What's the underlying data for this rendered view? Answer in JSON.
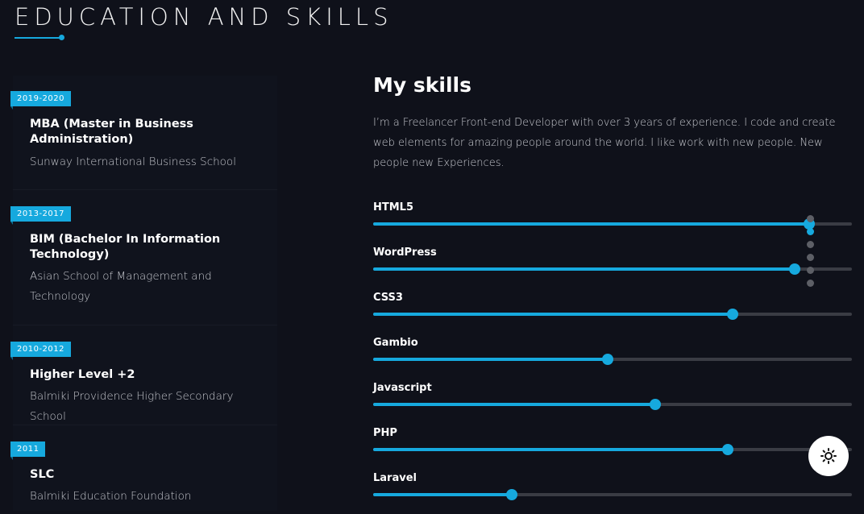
{
  "section": {
    "title": "EDUCATION AND SKILLS"
  },
  "education": [
    {
      "year": "2019-2020",
      "degree": "MBA (Master in Business Administration)",
      "school": "Sunway International Business School"
    },
    {
      "year": "2013-2017",
      "degree": "BIM (Bachelor In Information Technology)",
      "school": "Asian School of Management and Technology"
    },
    {
      "year": "2010-2012",
      "degree": "Higher Level +2",
      "school": "Balmiki Providence Higher Secondary School"
    },
    {
      "year": "2011",
      "degree": "SLC",
      "school": "Balmiki Education Foundation"
    }
  ],
  "skills": {
    "title": "My skills",
    "description": "I’m a Freelancer Front-end Developer with over 3 years of experience. I code and create web elements for amazing people around the world. I like work with new people. New people new Experiences.",
    "items": [
      {
        "name": "HTML5",
        "level": 0.91
      },
      {
        "name": "WordPress",
        "level": 0.88
      },
      {
        "name": "CSS3",
        "level": 0.75
      },
      {
        "name": "Gambio",
        "level": 0.49
      },
      {
        "name": "Javascript",
        "level": 0.59
      },
      {
        "name": "PHP",
        "level": 0.74
      },
      {
        "name": "Laravel",
        "level": 0.29
      }
    ]
  },
  "page_nav": {
    "dot_count": 6,
    "active_index": 1
  },
  "theme_toggle": {
    "icon": "sun-icon"
  },
  "colors": {
    "accent": "#16a9de",
    "background": "#0f111a",
    "track": "#3a3c44"
  }
}
